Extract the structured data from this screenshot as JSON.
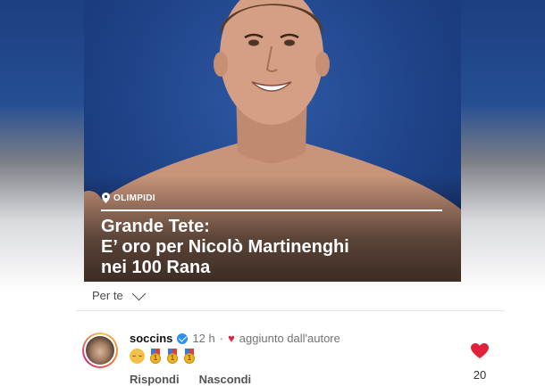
{
  "post": {
    "category": "OLIMPIDI",
    "headline_lines": [
      "Grande Tete:",
      "E’ oro per Nicolò Martinenghi",
      "nei 100 Rana"
    ]
  },
  "feed": {
    "filter_label": "Per te",
    "filter_icon": "chevron-down-icon"
  },
  "comment": {
    "username": "soccins",
    "time": "12 h",
    "separator": "·",
    "author_label": "aggiunto dall'autore",
    "emojis": [
      "relieved-face-emoji",
      "gold-medal-emoji",
      "gold-medal-emoji",
      "gold-medal-emoji"
    ],
    "reply_label": "Rispondi",
    "hide_label": "Nascondi",
    "likes": "20"
  },
  "colors": {
    "accent_heart": "#e0233a",
    "verified_blue": "#2f8ef3"
  }
}
